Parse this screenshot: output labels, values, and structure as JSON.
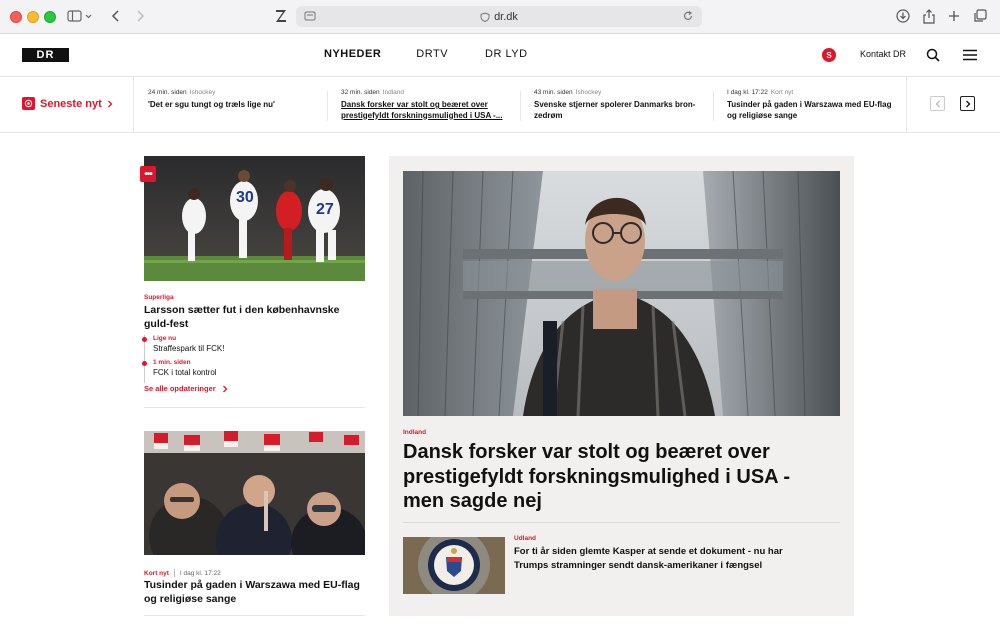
{
  "browser": {
    "url": "dr.dk"
  },
  "header": {
    "logo": "DR",
    "nav": [
      "NYHEDER",
      "DRTV",
      "DR LYD"
    ],
    "user_initial": "S",
    "contact": "Kontakt DR"
  },
  "ticker": {
    "label": "Seneste nyt",
    "items": [
      {
        "time": "24 min. siden",
        "category": "Ishockey",
        "title": "'Det er sgu tungt og træls lige nu'"
      },
      {
        "time": "32 min. siden",
        "category": "Indland",
        "title": "Dansk forsker var stolt og beæret over prestigefyldt forskningsmulighed i USA -..."
      },
      {
        "time": "43 min. siden",
        "category": "Ishockey",
        "title": "Svenske stjerner spolerer Danmarks bron-zedrøm"
      },
      {
        "time": "I dag kl. 17:22",
        "category": "Kort nyt",
        "title": "Tusinder på gaden i Warszawa med EU-flag og religiøse sange"
      }
    ]
  },
  "left_articles": {
    "football": {
      "label": "Superliga",
      "title": "Larsson sætter fut i den københavnske guld-fest",
      "updates": [
        {
          "meta": "Lige nu",
          "text": "Straffespark til FCK!"
        },
        {
          "meta": "1 min. siden",
          "text": "FCK i total kontrol"
        }
      ],
      "see_all": "Se alle opdateringer"
    },
    "warsaw": {
      "label": "Kort nyt",
      "time": "I dag kl. 17:22",
      "title": "Tusinder på gaden i Warszawa med EU-flag og religiøse sange"
    }
  },
  "feature": {
    "label": "Indland",
    "title": "Dansk forsker var stolt og beæret over prestigefyldt forskningsmulighed i USA - men sagde nej",
    "sub": {
      "label": "Udland",
      "title": "For ti år siden glemte Kasper at sende et dokument - nu har Trumps stramninger sendt dansk-amerikaner i fængsel"
    }
  },
  "colors": {
    "accent": "#e0152b",
    "feature_bg": "#f2f0ee"
  }
}
